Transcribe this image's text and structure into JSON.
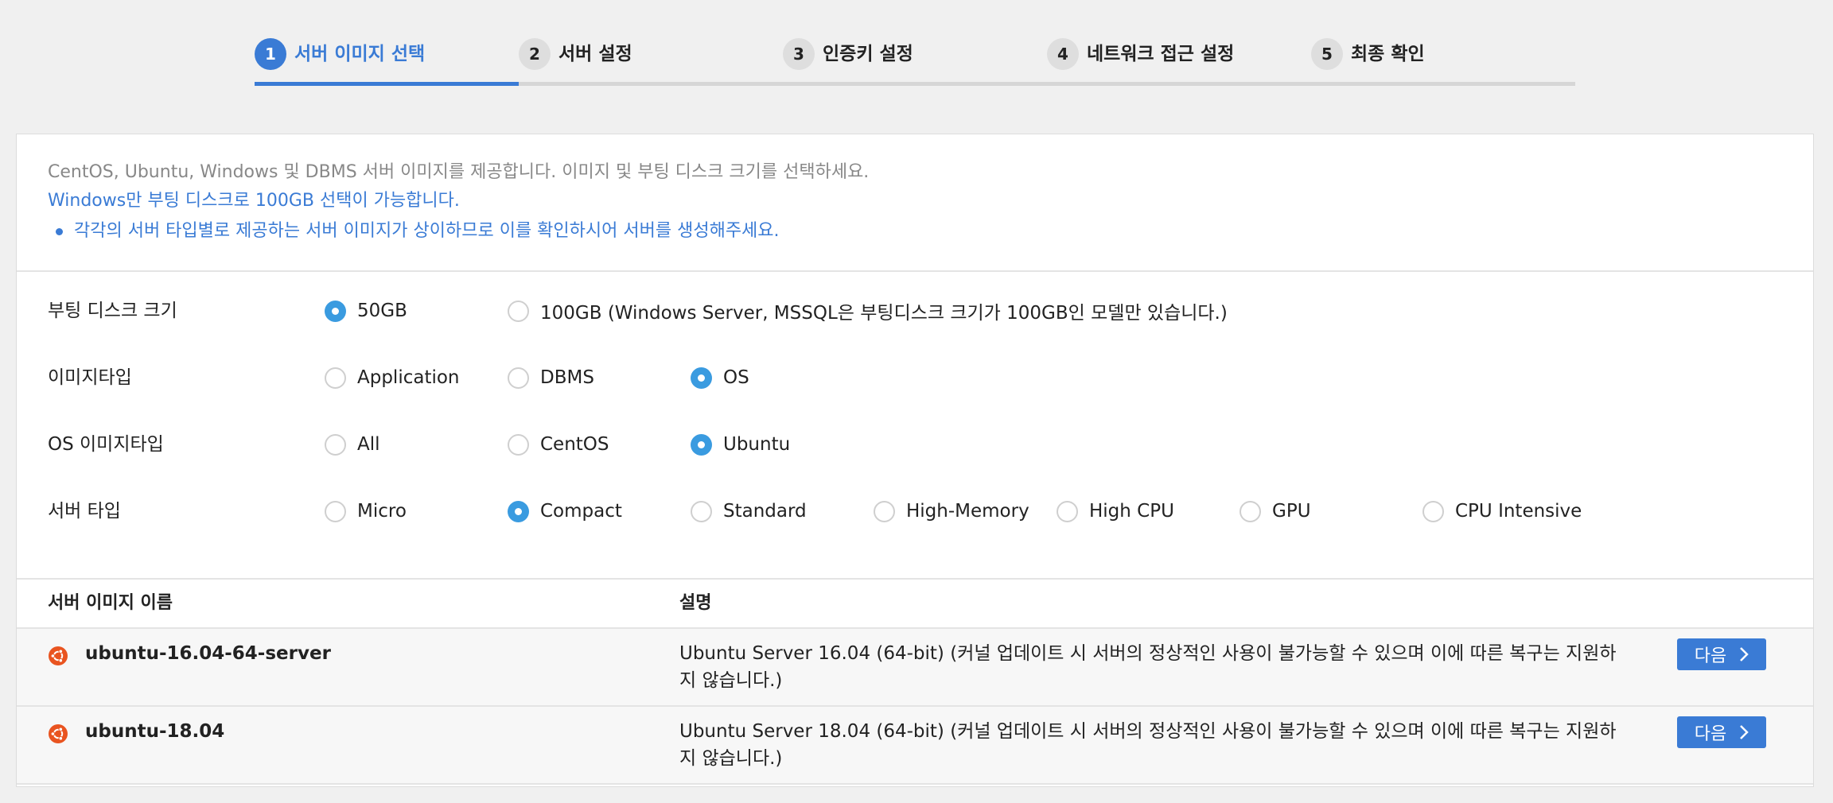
{
  "stepper": {
    "steps": [
      {
        "number": "1",
        "label": "서버 이미지 선택",
        "active": true
      },
      {
        "number": "2",
        "label": "서버 설정",
        "active": false
      },
      {
        "number": "3",
        "label": "인증키 설정",
        "active": false
      },
      {
        "number": "4",
        "label": "네트워크 접근 설정",
        "active": false
      },
      {
        "number": "5",
        "label": "최종 확인",
        "active": false
      }
    ]
  },
  "notice": {
    "line1": "CentOS, Ubuntu, Windows 및 DBMS 서버 이미지를 제공합니다. 이미지 및 부팅 디스크 크기를 선택하세요.",
    "line2": "Windows만 부팅 디스크로 100GB 선택이 가능합니다.",
    "bullet": "각각의 서버 타입별로 제공하는 서버 이미지가 상이하므로 이를 확인하시어 서버를 생성해주세요."
  },
  "options": {
    "boot_disk": {
      "label": "부팅 디스크 크기",
      "choices": [
        "50GB",
        "100GB (Windows Server, MSSQL은 부팅디스크 크기가 100GB인 모델만 있습니다.)"
      ],
      "selected": "50GB"
    },
    "image_type": {
      "label": "이미지타입",
      "choices": [
        "Application",
        "DBMS",
        "OS"
      ],
      "selected": "OS"
    },
    "os_image_type": {
      "label": "OS 이미지타입",
      "choices": [
        "All",
        "CentOS",
        "Ubuntu"
      ],
      "selected": "Ubuntu"
    },
    "server_type": {
      "label": "서버 타입",
      "choices": [
        "Micro",
        "Compact",
        "Standard",
        "High-Memory",
        "High CPU",
        "GPU",
        "CPU Intensive"
      ],
      "selected": "Compact"
    }
  },
  "table": {
    "headers": {
      "name": "서버 이미지 이름",
      "description": "설명"
    },
    "rows": [
      {
        "icon": "ubuntu-icon",
        "name": "ubuntu-16.04-64-server",
        "description": "Ubuntu Server 16.04 (64-bit) (커널 업데이트 시 서버의 정상적인 사용이 불가능할 수 있으며 이에 따른 복구는 지원하지 않습니다.)",
        "button_label": "다음"
      },
      {
        "icon": "ubuntu-icon",
        "name": "ubuntu-18.04",
        "description": "Ubuntu Server 18.04 (64-bit) (커널 업데이트 시 서버의 정상적인 사용이 불가능할 수 있으며 이에 따른 복구는 지원하지 않습니다.)",
        "button_label": "다음"
      }
    ]
  },
  "colors": {
    "accent": "#3a7bd5",
    "radio_checked": "#3a9be0",
    "ubuntu_orange": "#e95420"
  }
}
